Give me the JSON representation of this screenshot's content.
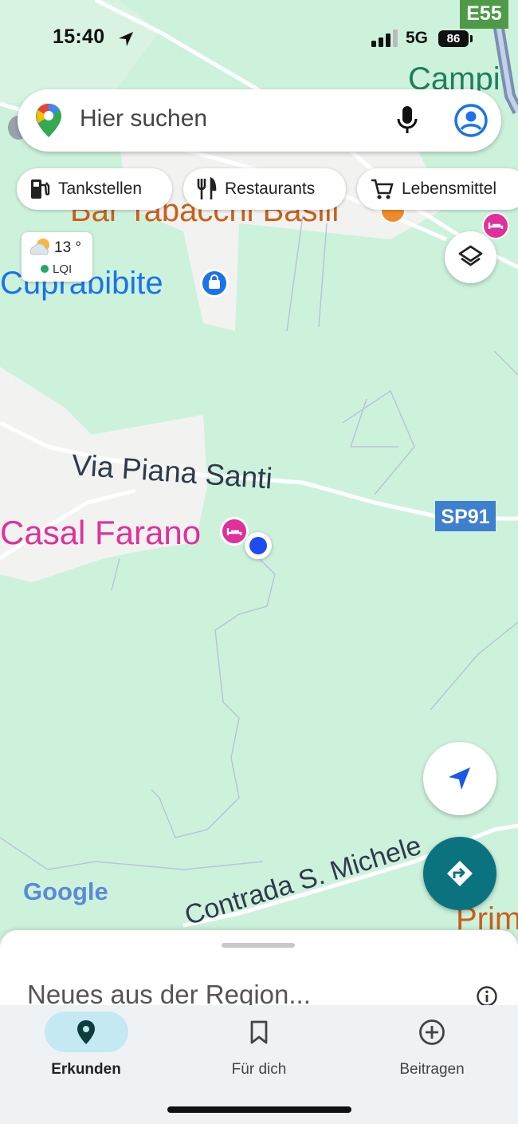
{
  "status_bar": {
    "time": "15:40",
    "network": "5G",
    "battery": "86"
  },
  "search": {
    "placeholder": "Hier suchen"
  },
  "chips": [
    {
      "label": "Tankstellen",
      "icon": "gas-station-icon"
    },
    {
      "label": "Restaurants",
      "icon": "restaurant-icon"
    },
    {
      "label": "Lebensmittel",
      "icon": "cart-icon"
    }
  ],
  "weather": {
    "temp": "13 °",
    "aq_label": "LQI"
  },
  "map": {
    "top_label": "Campi",
    "road_badge_e": "E55",
    "road_badge_sp": "SP91",
    "place_bar": "Bar Tabacchi Basili",
    "place_shop": "Cuprabibite",
    "street_1": "Via Piana Santi",
    "place_hotel": "Casal Farano",
    "street_2": "Contrada S. Michele",
    "place_bottom": "Prim",
    "attribution": "Google"
  },
  "sheet": {
    "title": "Neues aus der Region..."
  },
  "nav": {
    "items": [
      {
        "label": "Erkunden",
        "active": true
      },
      {
        "label": "Für dich",
        "active": false
      },
      {
        "label": "Beitragen",
        "active": false
      }
    ]
  },
  "colors": {
    "map_bg": "#cdf2dc",
    "road": "#ffffff",
    "label_orange": "#c95f1b",
    "label_blue": "#1a73e8",
    "label_pink": "#e0309a",
    "street_text": "#2f3a4d",
    "teal": "#0b7380",
    "sp_badge": "#3e7fd0",
    "e_badge": "#4f9a47"
  }
}
